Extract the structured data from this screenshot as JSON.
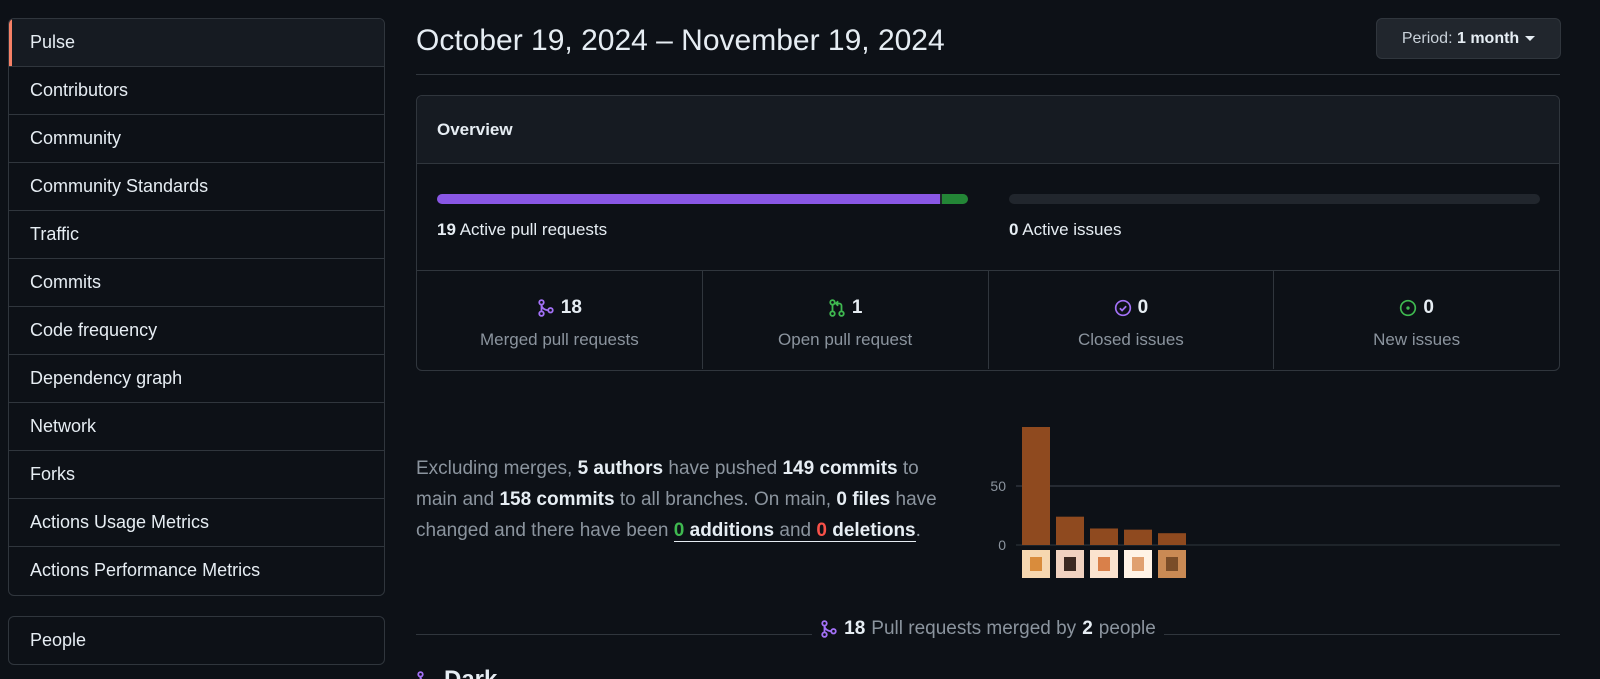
{
  "sidebar": {
    "items": [
      {
        "label": "Pulse",
        "active": true
      },
      {
        "label": "Contributors"
      },
      {
        "label": "Community"
      },
      {
        "label": "Community Standards"
      },
      {
        "label": "Traffic"
      },
      {
        "label": "Commits"
      },
      {
        "label": "Code frequency"
      },
      {
        "label": "Dependency graph"
      },
      {
        "label": "Network"
      },
      {
        "label": "Forks"
      },
      {
        "label": "Actions Usage Metrics"
      },
      {
        "label": "Actions Performance Metrics"
      }
    ],
    "people_label": "People",
    "active_accent": "#f78166"
  },
  "header": {
    "title": "October 19, 2024 – November 19, 2024",
    "period_label": "Period:",
    "period_value": "1 month"
  },
  "overview": {
    "heading": "Overview",
    "active_prs_count": "19",
    "active_prs_label": "Active pull requests",
    "active_prs_merged_fraction": 0.947,
    "active_issues_count": "0",
    "active_issues_label": "Active issues",
    "stats": [
      {
        "icon": "git-merge-icon",
        "value": "18",
        "caption": "Merged pull requests",
        "color": "#a371f7"
      },
      {
        "icon": "git-pull-request-icon",
        "value": "1",
        "caption": "Open pull request",
        "color": "#3fb950"
      },
      {
        "icon": "issue-closed-icon",
        "value": "0",
        "caption": "Closed issues",
        "color": "#a371f7"
      },
      {
        "icon": "issue-opened-icon",
        "value": "0",
        "caption": "New issues",
        "color": "#3fb950"
      }
    ]
  },
  "summary": {
    "t1": "Excluding merges, ",
    "authors": "5 authors",
    "t2": " have pushed ",
    "commits_main": "149 commits",
    "t3": " to main and ",
    "commits_all": "158 commits",
    "t4": " to all branches. On main, ",
    "files": "0 files",
    "t5": " have changed and there have been ",
    "additions_num": "0",
    "additions_word": " additions",
    "and": " and ",
    "deletions_num": "0",
    "deletions_word": " deletions",
    "end": "."
  },
  "chart_data": {
    "type": "bar",
    "categories": [
      "author-1",
      "author-2",
      "author-3",
      "author-4",
      "author-5"
    ],
    "values": [
      100,
      24,
      14,
      13,
      10
    ],
    "yticks": [
      "0",
      "50"
    ],
    "ylim": [
      0,
      100
    ],
    "bar_color": "#8f4a1f"
  },
  "pull_requests": {
    "count": "18",
    "text": "Pull requests merged by",
    "people_count": "2",
    "people_word": "people"
  },
  "next_section": {
    "heading_partial": "Dark"
  }
}
